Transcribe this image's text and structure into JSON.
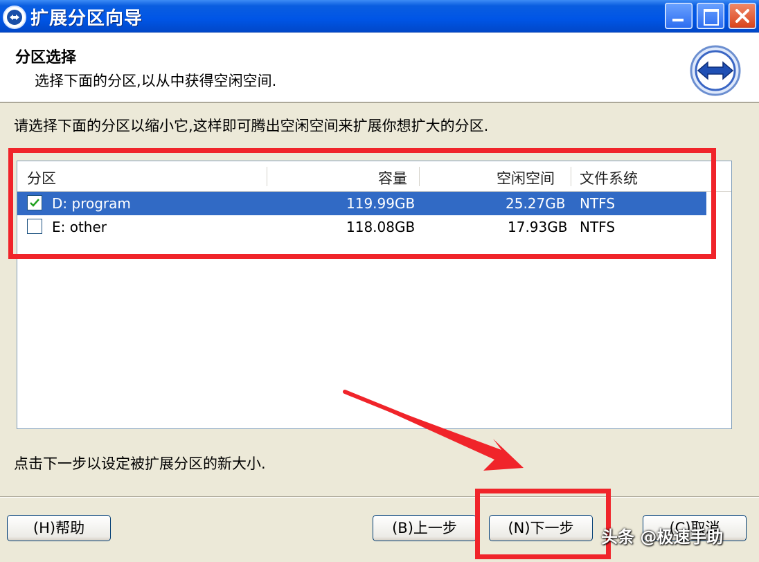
{
  "window": {
    "title": "扩展分区向导",
    "controls": [
      "minimize-icon",
      "maximize-icon",
      "close-icon"
    ]
  },
  "header": {
    "title": "分区选择",
    "subtitle": "选择下面的分区,以从中获得空闲空间.",
    "icon": "expand-arrows-icon"
  },
  "instruction": "请选择下面的分区以缩小它,这样即可腾出空闲空间来扩展你想扩大的分区.",
  "table": {
    "columns": [
      "分区",
      "容量",
      "空闲空间",
      "文件系统"
    ],
    "rows": [
      {
        "name": "D: program",
        "capacity": "119.99GB",
        "free": "25.27GB",
        "fs": "NTFS",
        "checked": true,
        "selected": true
      },
      {
        "name": "E: other",
        "capacity": "118.08GB",
        "free": "17.93GB",
        "fs": "NTFS",
        "checked": false,
        "selected": false
      }
    ]
  },
  "hint": "点击下一步以设定被扩展分区的新大小.",
  "buttons": {
    "help": "(H)帮助",
    "back": "(B)上一步",
    "next": "(N)下一步",
    "cancel": "(C)取消"
  },
  "watermark": "头条 @极速手助",
  "colors": {
    "title_bar": "#0055e6",
    "selection": "#316ac5",
    "highlight": "#f0242a",
    "background": "#ece9d8"
  }
}
